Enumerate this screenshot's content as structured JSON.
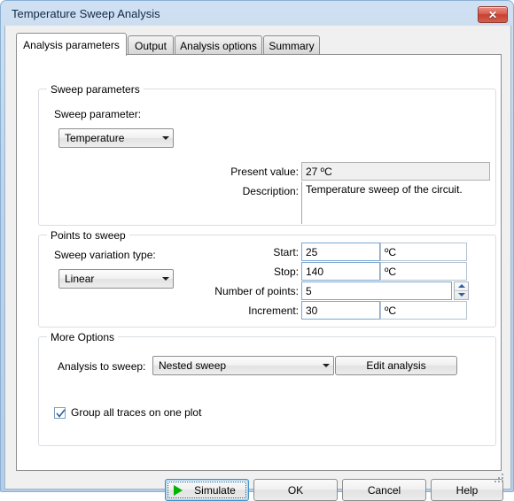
{
  "window": {
    "title": "Temperature Sweep Analysis",
    "close_label": "✕",
    "close_icon": "close-icon"
  },
  "tabs": [
    {
      "label": "Analysis parameters",
      "active": true
    },
    {
      "label": "Output",
      "active": false
    },
    {
      "label": "Analysis options",
      "active": false
    },
    {
      "label": "Summary",
      "active": false
    }
  ],
  "sweep_parameters": {
    "group_title": "Sweep parameters",
    "parameter_label": "Sweep parameter:",
    "parameter_value": "Temperature",
    "present_value_label": "Present value:",
    "present_value": "27 ºC",
    "description_label": "Description:",
    "description_value": "Temperature sweep of the circuit."
  },
  "points_to_sweep": {
    "group_title": "Points to sweep",
    "variation_label": "Sweep variation type:",
    "variation_value": "Linear",
    "rows": [
      {
        "label": "Start:",
        "value": "25",
        "unit": "ºC"
      },
      {
        "label": "Stop:",
        "value": "140",
        "unit": "ºC"
      },
      {
        "label": "Number of points:",
        "value": "5",
        "unit": ""
      },
      {
        "label": "Increment:",
        "value": "30",
        "unit": "ºC"
      }
    ]
  },
  "more_options": {
    "group_title": "More Options",
    "analysis_label": "Analysis to sweep:",
    "analysis_value": "Nested sweep",
    "edit_analysis_label": "Edit analysis",
    "group_traces_label": "Group all traces on one plot",
    "group_traces_checked": true
  },
  "footer": {
    "simulate_label": "Simulate",
    "ok_label": "OK",
    "cancel_label": "Cancel",
    "help_label": "Help"
  }
}
